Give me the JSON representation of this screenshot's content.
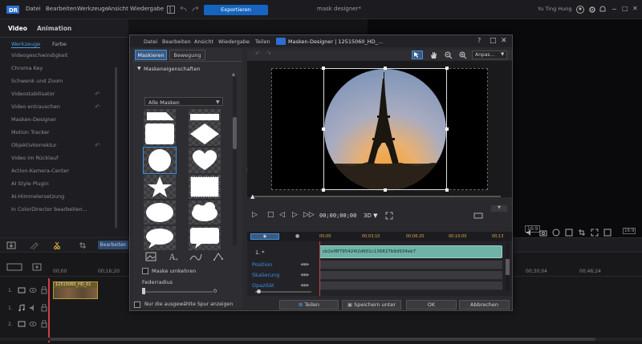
{
  "app": {
    "menus": [
      "Datei",
      "Bearbeiten",
      "Werkzeuge",
      "Ansicht",
      "Wiedergabe"
    ],
    "export_label": "Exportieren",
    "project_title": "mask designer*",
    "user_name": "Yu Ting Hung"
  },
  "left_panel": {
    "tabs": [
      "Video",
      "Animation"
    ],
    "subtabs": [
      "Werkzeuge",
      "Farbe"
    ],
    "items": [
      "Videogeschwindigkeit",
      "Chroma Key",
      "Schwenk und Zoom",
      "Videostabilisator",
      "Video entrauschen",
      "Masken-Designer",
      "Motion Tracker",
      "Objektivkorrektur",
      "Video im Rücklauf",
      "Action-Kamera-Center",
      "AI Style Plugin",
      "AI-Himmelersetzung",
      "In ColorDirector bearbeiten..."
    ]
  },
  "timeline": {
    "edit_label": "Bearbeiten",
    "ruler": [
      "00;00",
      "00;16;20",
      "00;30;04",
      "00;46;24"
    ],
    "clip_name": "12515060_HD_01",
    "tracks": [
      "1.",
      "1.",
      "2."
    ]
  },
  "dialog": {
    "menus": [
      "Datei",
      "Bearbeiten",
      "Ansicht",
      "Wiedergabe",
      "Teilen"
    ],
    "title": "Masken-Designer  |  12515060_HD_...",
    "help": "?",
    "tabs": [
      "Maskieren",
      "Bewegung"
    ],
    "section_title": "Maskeneigenschaften",
    "mask_dropdown": "Alle Masken",
    "invert_label": "Maske umkehren",
    "feather_label": "Federradius",
    "feather_value": "0",
    "only_selected_label": "Nur die ausgewählte Spur anzeigen",
    "fit_label": "Anpas...",
    "timecode": "00;00;00;00",
    "mode_3d": "3D ▼",
    "ruler": [
      "00;00",
      "00;03;10",
      "00;06;20",
      "00;10;00",
      "00;13"
    ],
    "track_label": "1. *",
    "track_clip_id": "cb2ef8f795424l2d601c136827b9d934eb7",
    "properties": [
      "Position",
      "Skalierung",
      "Opazität"
    ],
    "buttons": {
      "share": "Teilen",
      "save_as": "Speichern unter",
      "ok": "OK",
      "cancel": "Abbrechen"
    }
  },
  "colors": {
    "accent": "#3b8fe0",
    "export_btn": "#1565c0",
    "track_clip": "#6fb3a8"
  }
}
